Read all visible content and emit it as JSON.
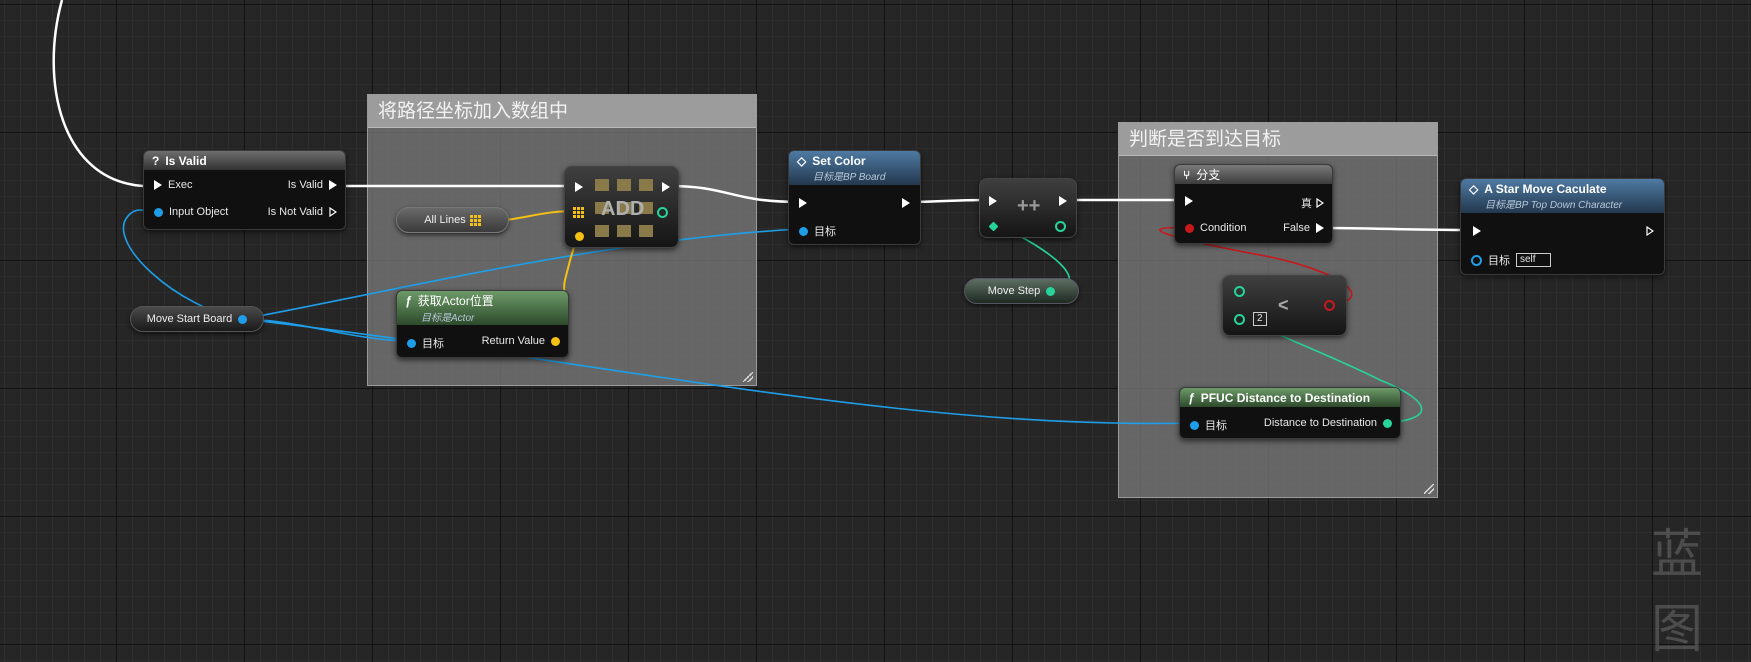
{
  "comments": [
    {
      "title": "将路径坐标加入数组中"
    },
    {
      "title": "判断是否到达目标"
    }
  ],
  "is_valid": {
    "icon": "question-icon",
    "title": "Is Valid",
    "exec_in": "Exec",
    "input_object": "Input Object",
    "is_valid_out": "Is Valid",
    "is_not_valid_out": "Is Not Valid"
  },
  "move_start_board": {
    "label": "Move Start Board"
  },
  "all_lines": {
    "label": "All Lines"
  },
  "add_node": {
    "label": "ADD"
  },
  "get_actor_location": {
    "title": "获取Actor位置",
    "subtitle": "目标是Actor",
    "target": "目标",
    "return_value": "Return Value"
  },
  "set_color": {
    "title": "Set Color",
    "subtitle": "目标是BP Board",
    "target": "目标"
  },
  "increment": {
    "label": "++"
  },
  "move_step": {
    "label": "Move Step"
  },
  "branch": {
    "title": "分支",
    "true_out": "真",
    "condition": "Condition",
    "false_out": "False"
  },
  "less_than": {
    "label": "<",
    "literal": "2"
  },
  "pfuc_distance": {
    "title": "PFUC Distance to Destination",
    "target": "目标",
    "output": "Distance to Destination"
  },
  "a_star": {
    "title": "A Star Move Caculate",
    "subtitle": "目标是BP Top Down Character",
    "target": "目标",
    "self": "self"
  },
  "watermark": "蓝图",
  "colors": {
    "exec": "#ffffff",
    "object": "#1e9ee8",
    "integer": "#27d39a",
    "vector": "#f3c013",
    "bool": "#c7181b"
  }
}
